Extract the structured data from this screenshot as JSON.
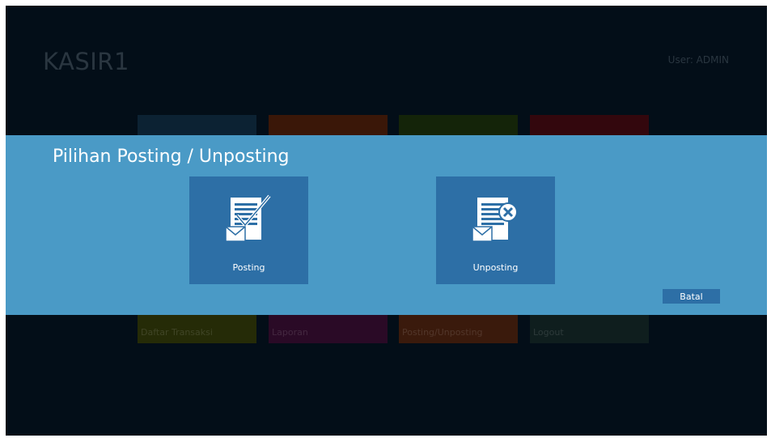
{
  "app": {
    "title": "KASIR1",
    "user_text": "User: ADMIN"
  },
  "background_tiles": [
    {
      "label": "",
      "color": "#0c2233"
    },
    {
      "label": "",
      "color": "#3a1708"
    },
    {
      "label": "",
      "color": "#142409"
    },
    {
      "label": "",
      "color": "#33070d"
    },
    {
      "label": "Daftar Transaksi",
      "color": "#252b07"
    },
    {
      "label": "Laporan",
      "color": "#2a0a26"
    },
    {
      "label": "Posting/Unposting",
      "color": "#3a1a0c"
    },
    {
      "label": "Logout",
      "color": "#0f1e1e"
    }
  ],
  "dialog": {
    "title": "Pilihan Posting / Unposting",
    "options": [
      {
        "label": "Posting",
        "icon": "document-check-envelope-icon"
      },
      {
        "label": "Unposting",
        "icon": "document-x-envelope-icon"
      }
    ],
    "cancel_label": "Batal"
  },
  "colors": {
    "screen_bg": "#030e18",
    "dialog_bg": "#4a9ac6",
    "tile_bg": "#2d6fa6"
  }
}
